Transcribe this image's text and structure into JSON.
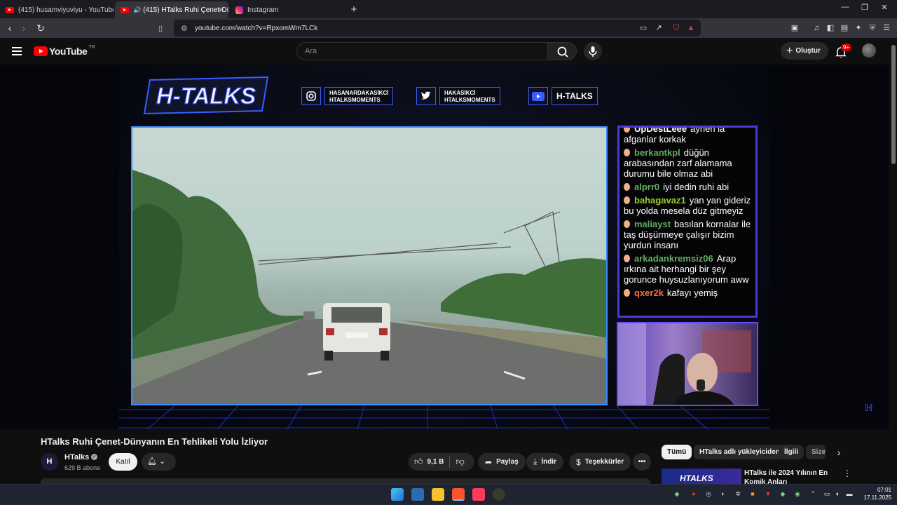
{
  "browser": {
    "tabs": [
      {
        "label": "(415) husamviyuviyu - YouTube",
        "active": false,
        "icon": "youtube-icon"
      },
      {
        "label": "(415) HTalks Ruhi Çenet-Düny",
        "active": true,
        "icon": "youtube-icon"
      },
      {
        "label": "Instagram",
        "active": false,
        "icon": "instagram-icon"
      }
    ],
    "url": "youtube.com/watch?v=RpxomWm7LCk"
  },
  "youtube": {
    "logo_text": "YouTube",
    "logo_region": "TR",
    "search_placeholder": "Ara",
    "create_label": "Oluştur",
    "notif_count": "9+"
  },
  "video_overlay": {
    "logo_text": "H-TALKS",
    "socials": [
      {
        "icon": "instagram-icon",
        "line1": "HASANARDAKASİKCİ",
        "line2": "HTALKSMOMENTS"
      },
      {
        "icon": "twitter-icon",
        "line1": "HAKASİKCİ",
        "line2": "HTALKSMOMENTS"
      },
      {
        "icon": "youtube-icon",
        "line1": "H-TALKS",
        "line2": ""
      }
    ],
    "chat": [
      {
        "user": "UpDestLeee",
        "text": "aynen la afganlar korkak",
        "color": "#ffffff"
      },
      {
        "user": "berkantkpl",
        "text": "düğün arabasından zarf alamama durumu bile olmaz abi",
        "color": "#5fae5f"
      },
      {
        "user": "alprr0",
        "text": "iyi dedin ruhi abi",
        "color": "#5fae5f"
      },
      {
        "user": "bahagavaz1",
        "text": "yan yan gideriz bu yolda mesela düz gitmeyiz",
        "color": "#9acd32"
      },
      {
        "user": "maliayst",
        "text": "basılan kornalar ile taş düşürmeye çalışır bizim yurdun insanı",
        "color": "#5fae5f"
      },
      {
        "user": "arkadankremsiz06",
        "text": "Arap ırkına ait herhangi bir şey gorunce huysuzlanıyorum aww",
        "color": "#5fae5f"
      },
      {
        "user": "qxer2k",
        "text": "kafayı yemiş",
        "color": "#ff6a3d"
      }
    ]
  },
  "video": {
    "title": "HTalks Ruhi Çenet-Dünyanın En Tehlikeli Yolu İzliyor",
    "channel": "HTalks",
    "subscribers": "629 B abone",
    "join_label": "Katıl",
    "likes": "9,1 B",
    "share_label": "Paylaş",
    "download_label": "İndir",
    "thanks_label": "Teşekkürler"
  },
  "sidebar": {
    "chips": [
      "Tümü",
      "HTalks adlı yükleyiciden",
      "İlgili",
      "Size"
    ],
    "related": [
      {
        "thumb_text": "HTALKS",
        "title": "HTalks ile 2024 Yılının En Komik Anları"
      }
    ]
  },
  "taskbar": {
    "time": "07:01",
    "date": "17.11.2025"
  }
}
